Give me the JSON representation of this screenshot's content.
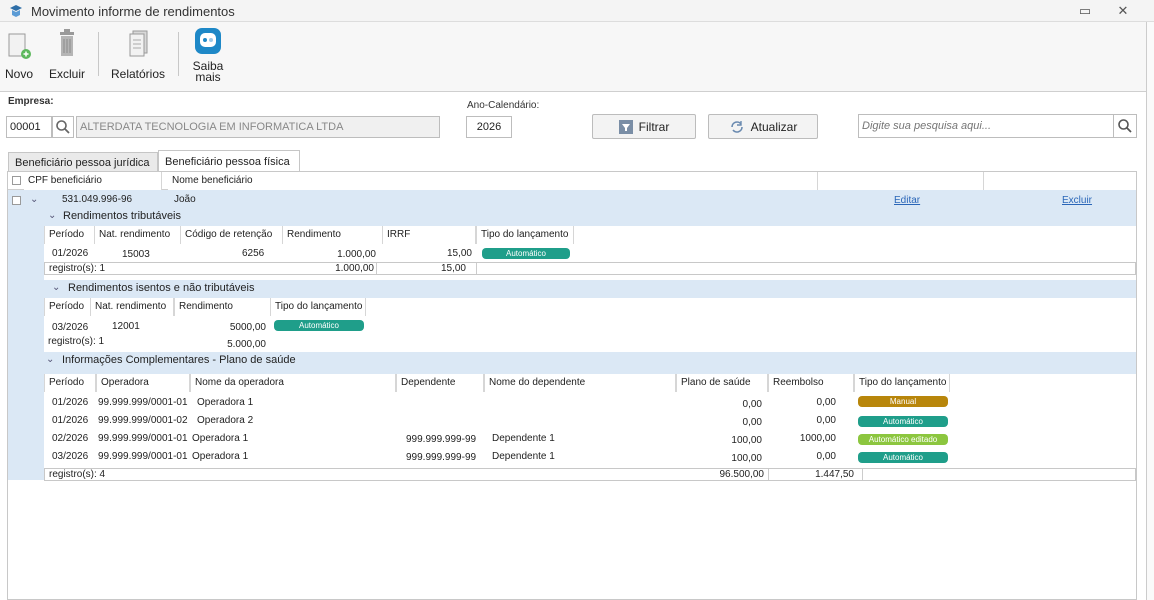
{
  "window": {
    "title": "Movimento informe de rendimentos"
  },
  "toolbar": {
    "novo": "Novo",
    "excluir": "Excluir",
    "relatorios": "Relatórios",
    "saiba_1": "Saiba",
    "saiba_2": "mais"
  },
  "filter": {
    "empresa_label": "Empresa:",
    "empresa_code": "00001",
    "empresa_name": "ALTERDATA TECNOLOGIA EM INFORMATICA LTDA",
    "ano_label": "Ano-Calendário:",
    "ano_value": "2026",
    "filtrar": "Filtrar",
    "atualizar": "Atualizar",
    "search_placeholder": "Digite sua pesquisa aqui..."
  },
  "tabs": [
    "Beneficiário pessoa jurídica",
    "Beneficiário pessoa física"
  ],
  "grid": {
    "headers": [
      "CPF beneficiário",
      "Nome beneficiário"
    ],
    "row": {
      "cpf": "531.049.996-96",
      "nome": "João",
      "editar": "Editar",
      "excluir": "Excluir"
    }
  },
  "trib": {
    "title": "Rendimentos tributáveis",
    "headers": [
      "Período",
      "Nat. rendimento",
      "Código de retenção",
      "Rendimento",
      "IRRF",
      "Tipo do lançamento"
    ],
    "row": {
      "periodo": "01/2026",
      "nat": "15003",
      "codigo": "6256",
      "rendimento": "1.000,00",
      "irrf": "15,00",
      "tipo": "Automático"
    },
    "footer": {
      "count": "registro(s): 1",
      "rendimento": "1.000,00",
      "irrf": "15,00"
    }
  },
  "isentos": {
    "title": "Rendimentos isentos e não tributáveis",
    "headers": [
      "Período",
      "Nat. rendimento",
      "Rendimento",
      "Tipo do lançamento"
    ],
    "row": {
      "periodo": "03/2026",
      "nat": "12001",
      "rendimento": "5000,00",
      "tipo": "Automático"
    },
    "footer": {
      "count": "registro(s): 1",
      "rendimento": "5.000,00"
    }
  },
  "saude": {
    "title": "Informações Complementares - Plano de saúde",
    "headers": [
      "Período",
      "Operadora",
      "Nome da operadora",
      "Dependente",
      "Nome do dependente",
      "Plano de saúde",
      "Reembolso",
      "Tipo do lançamento"
    ],
    "rows": [
      {
        "periodo": "01/2026",
        "operadora": "99.999.999/0001-01",
        "nome_op": "Operadora 1",
        "dep": "",
        "nome_dep": "",
        "plano": "0,00",
        "reembolso": "0,00",
        "tipo": "Manual",
        "color": "#b8860b"
      },
      {
        "periodo": "01/2026",
        "operadora": "99.999.999/0001-02",
        "nome_op": "Operadora 2",
        "dep": "",
        "nome_dep": "",
        "plano": "0,00",
        "reembolso": "0,00",
        "tipo": "Automático",
        "color": "#1f9e8a"
      },
      {
        "periodo": "02/2026",
        "operadora": "99.999.999/0001-01",
        "nome_op": "Operadora 1",
        "dep": "999.999.999-99",
        "nome_dep": "Dependente 1",
        "plano": "100,00",
        "reembolso": "1000,00",
        "tipo": "Automático editado",
        "color": "#8cc63f"
      },
      {
        "periodo": "03/2026",
        "operadora": "99.999.999/0001-01",
        "nome_op": "Operadora 1",
        "dep": "999.999.999-99",
        "nome_dep": "Dependente 1",
        "plano": "100,00",
        "reembolso": "0,00",
        "tipo": "Automático",
        "color": "#1f9e8a"
      }
    ],
    "footer": {
      "count": "registro(s): 4",
      "plano": "96.500,00",
      "reembolso": "1.447,50"
    }
  }
}
